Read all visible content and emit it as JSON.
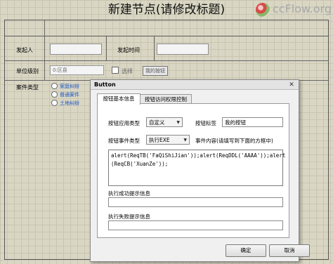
{
  "page": {
    "title": "新建节点(请修改标题)"
  },
  "logo": {
    "text": "ccFlow.org"
  },
  "form": {
    "initiator_label": "发起人",
    "start_time_label": "发起时间",
    "unit_level_label": "单位级别",
    "unit_level_value": "0:区县",
    "select_label": "选择",
    "my_button_label": "我的按钮",
    "case_type_label": "案件类型",
    "case_types": [
      "家庭纠纷",
      "普通案件",
      "土地纠纷"
    ]
  },
  "dialog": {
    "title": "Button",
    "close_glyph": "✕",
    "tabs": [
      {
        "label": "按钮基本信息",
        "active": true
      },
      {
        "label": "按钮访问权限控制",
        "active": false
      }
    ],
    "app_type_label": "按钮应用类型",
    "app_type_value": "自定义",
    "button_label_label": "按钮标签",
    "button_label_value": "我的按钮",
    "event_type_label": "按钮事件类型",
    "event_type_value": "执行EXE",
    "event_content_label": "事件内容(请填写到下面的方框中)",
    "code": "alert(ReqTB('FaQiShiJian'));alert(ReqDDL('AAAA'));alert\n(ReqCB('XuanZe'));",
    "success_label": "执行成功提示信息",
    "success_value": "",
    "fail_label": "执行失败提示信息",
    "fail_value": "",
    "ok_label": "确定",
    "cancel_label": "取消"
  }
}
